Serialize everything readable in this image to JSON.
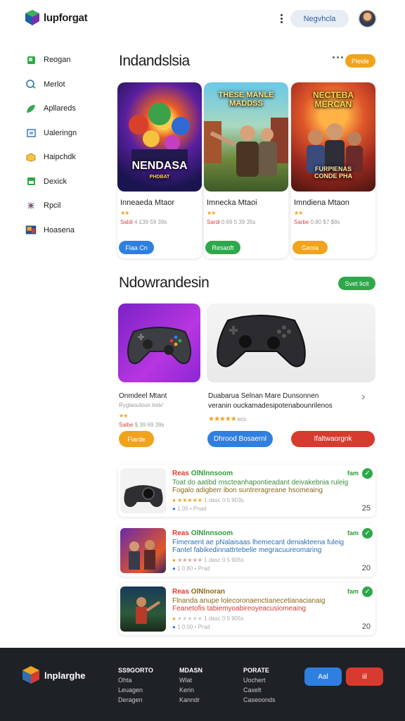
{
  "header": {
    "brand": "lupforgat",
    "top_button": "Negvhcla"
  },
  "sidebar": {
    "items": [
      {
        "label": "Reogan",
        "icon": "green-game-icon"
      },
      {
        "label": "Merlot",
        "icon": "blue-chat-icon"
      },
      {
        "label": "Apllareds",
        "icon": "leaf-icon"
      },
      {
        "label": "Ualeringn",
        "icon": "screen-icon"
      },
      {
        "label": "Haipchdk",
        "icon": "cube-icon"
      },
      {
        "label": "Dexick",
        "icon": "green-box-icon"
      },
      {
        "label": "Rpcil",
        "icon": "star-burst-icon"
      },
      {
        "label": "Hoasena",
        "icon": "tv-icon"
      }
    ]
  },
  "section1": {
    "title": "Indandslsia",
    "badge": "Pleide",
    "cards": [
      {
        "cover_title": "NENDASA",
        "cover_sub": "PHDBAT",
        "title": "Inneaeda Mtaor",
        "meta_red": "Saldi",
        "meta": "4 £39 59 39s",
        "button": "Fiaa Cn",
        "button_color": "#2f7fe0"
      },
      {
        "cover_title": "THESE MANLE\nMADDSS",
        "cover_sub": "",
        "title": "Imnecka Mtaoi",
        "meta_red": "Sardi",
        "meta": "0.69 5 39 35s",
        "button": "Resaoft",
        "button_color": "#2ea84a"
      },
      {
        "cover_title": "NECTEBA\nMERCAN",
        "cover_sub": "FURPIENAS\nCONDE PHA",
        "title": "Imndiena Mtaon",
        "meta_red": "Sarbe",
        "meta": "0.80 $7 $8s",
        "button": "Geoia",
        "button_color": "#f0a31c"
      }
    ]
  },
  "section2": {
    "title": "Ndowrandesin",
    "badge": "Svet Iicit",
    "left_title": "Onmdeel Mtant",
    "left_sub": "Ryglaoutoun treiv'",
    "left_meta_red": "Salbe",
    "left_meta": "$ 39 69 39s",
    "left_button": "Fiarde",
    "right_title": "Duabarua Selnan Mare Dunsonnen",
    "right_sub": "veranin ouckamadesipotenabounrilenos",
    "right_meta": "ecs",
    "right_btn_blue": "Dhrood Bosaernl",
    "right_btn_red": "Ifaltwaorgnk"
  },
  "list": [
    {
      "h_red": "Reas",
      "h_green": "OlNlnnsoom",
      "line1": "Toat do aatibd mscteanhapontieadant deivakebnia ruleig",
      "line2": "Fogalo adigberr ibon suntreragreane hsomeaing",
      "meta": "1 dasc 0 5 903s",
      "meta2": "1.05 • Pnad",
      "tag": "fam",
      "num": "25"
    },
    {
      "h_red": "Reas",
      "h_green": "OlNlnnsoom",
      "line1": "Fimeraent ae pNalaisaas lhemecant deniakteena fuleig",
      "line2": "Fantel fabikedinnattrtebelie megracuureomaring",
      "meta": "1 dasc 0 5 905s",
      "meta2": "1 0.80 • Prad",
      "tag": "fam",
      "num": "20"
    },
    {
      "h_red": "Reas",
      "h_green": "OlNlnoran",
      "line1": "Flnanda anupe lolecoronaenctianecetianacianaig",
      "line2": "Feanetofis tabiemyoabireoyeacusiomeaing",
      "meta": "1 dasc 0 5 905s",
      "meta2": "1 0.00 • Prad",
      "tag": "fam",
      "num": "20"
    }
  ],
  "footer": {
    "brand": "lnplarghe",
    "col1": {
      "head": "SS9GORTO",
      "items": [
        "Ohta",
        "Leuagen",
        "Deragen"
      ]
    },
    "col2": {
      "head": "MDASN",
      "items": [
        "Wlat",
        "Kerin",
        "Kanndr"
      ]
    },
    "col3": {
      "head": "PORATE",
      "items": [
        "Uochert",
        "Caxelt",
        "Caseoonds"
      ]
    },
    "btn_blue": "Aal",
    "btn_red": "iil"
  },
  "colors": {
    "accent_blue": "#2f7fe0",
    "accent_green": "#2ea84a",
    "accent_orange": "#f0a31c",
    "accent_red": "#d73a2f",
    "footer_bg": "#1e2126"
  }
}
